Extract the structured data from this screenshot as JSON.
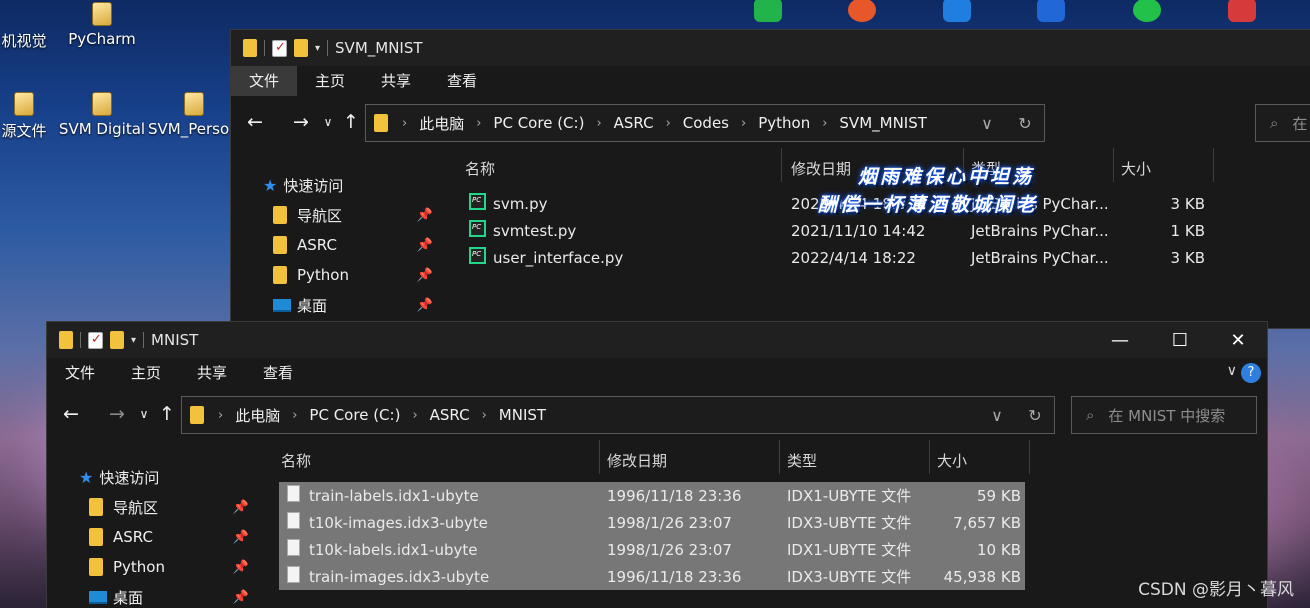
{
  "desktop": {
    "icons": [
      {
        "label": "机视觉"
      },
      {
        "label": "PyCharm"
      },
      {
        "label": "源文件"
      },
      {
        "label": "SVM Digital"
      },
      {
        "label": "SVM_Perso"
      }
    ],
    "tray_colors": [
      "#22b34b",
      "#e8572a",
      "#1f7ee0",
      "#2167d8",
      "#22c24a",
      "#d63a3a"
    ]
  },
  "back_window": {
    "title": "SVM_MNIST",
    "ribbon_tabs": [
      "文件",
      "主页",
      "共享",
      "查看"
    ],
    "breadcrumb": [
      "此电脑",
      "PC Core (C:)",
      "ASRC",
      "Codes",
      "Python",
      "SVM_MNIST"
    ],
    "search_placeholder": "在",
    "sidebar": {
      "quick_access": "快速访问",
      "items": [
        "导航区",
        "ASRC",
        "Python",
        "桌面"
      ]
    },
    "columns": [
      "名称",
      "修改日期",
      "类型",
      "大小"
    ],
    "files": [
      {
        "name": "svm.py",
        "date": "2022/4/14 18:3",
        "type": "JetBrains PyChar...",
        "size": "3 KB"
      },
      {
        "name": "svmtest.py",
        "date": "2021/11/10 14:42",
        "type": "JetBrains PyChar...",
        "size": "1 KB"
      },
      {
        "name": "user_interface.py",
        "date": "2022/4/14 18:22",
        "type": "JetBrains PyChar...",
        "size": "3 KB"
      }
    ]
  },
  "front_window": {
    "title": "MNIST",
    "ribbon_tabs": [
      "文件",
      "主页",
      "共享",
      "查看"
    ],
    "breadcrumb": [
      "此电脑",
      "PC Core (C:)",
      "ASRC",
      "MNIST"
    ],
    "search_placeholder": "在 MNIST 中搜索",
    "sidebar": {
      "quick_access": "快速访问",
      "items": [
        "导航区",
        "ASRC",
        "Python",
        "桌面"
      ]
    },
    "columns": [
      "名称",
      "修改日期",
      "类型",
      "大小"
    ],
    "files": [
      {
        "name": "train-labels.idx1-ubyte",
        "date": "1996/11/18 23:36",
        "type": "IDX1-UBYTE 文件",
        "size": "59 KB"
      },
      {
        "name": "t10k-images.idx3-ubyte",
        "date": "1998/1/26 23:07",
        "type": "IDX3-UBYTE 文件",
        "size": "7,657 KB"
      },
      {
        "name": "t10k-labels.idx1-ubyte",
        "date": "1998/1/26 23:07",
        "type": "IDX1-UBYTE 文件",
        "size": "10 KB"
      },
      {
        "name": "train-images.idx3-ubyte",
        "date": "1996/11/18 23:36",
        "type": "IDX3-UBYTE 文件",
        "size": "45,938 KB"
      }
    ]
  },
  "overlay": {
    "line1": "烟雨难保心中坦荡",
    "line2": "酬偿一杯薄酒敬城阑老"
  },
  "watermark": "CSDN @影月丶暮风"
}
